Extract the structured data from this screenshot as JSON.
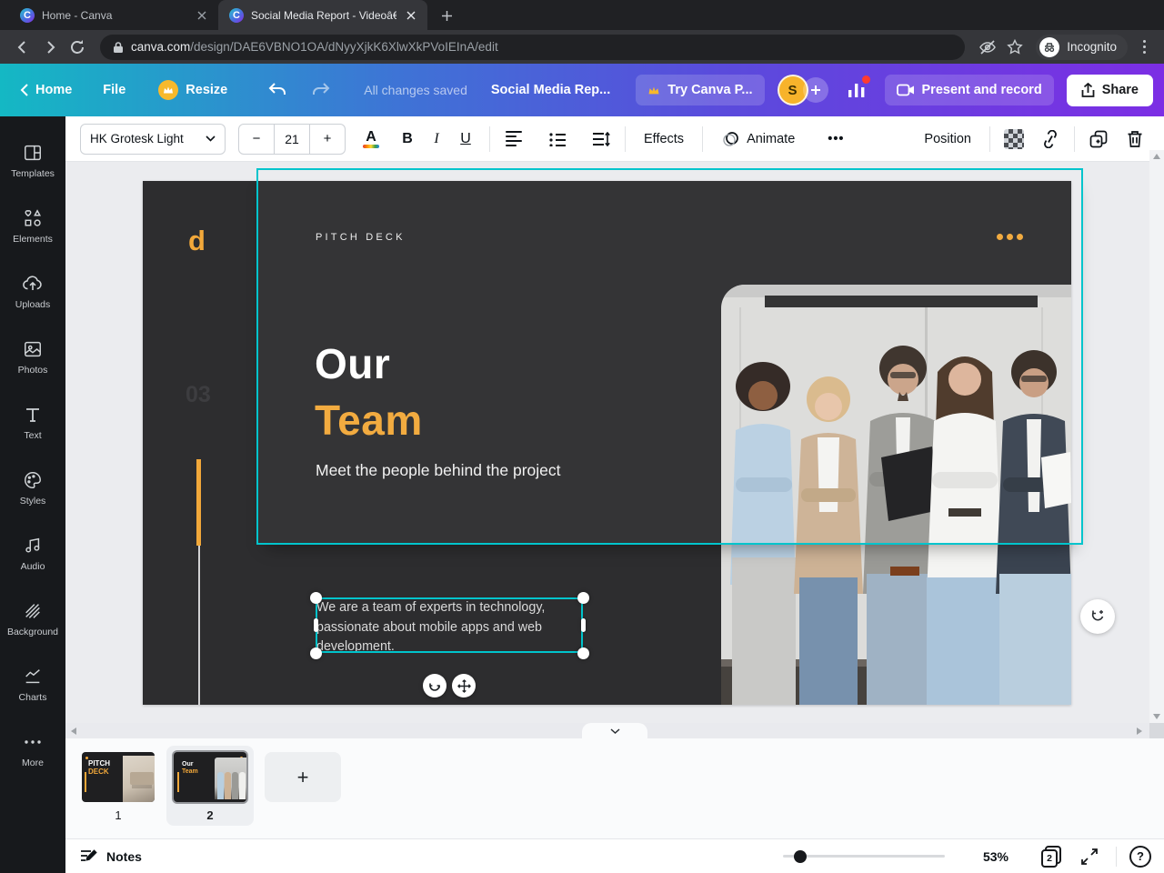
{
  "browser": {
    "tabs": [
      {
        "title": "Home - Canva"
      },
      {
        "title": "Social Media Report - Videoâ€¦"
      }
    ],
    "url_domain": "canva.com",
    "url_path": "/design/DAE6VBNO1OA/dNyyXjkK6XlwXkPVoIEInA/edit",
    "incognito_label": "Incognito"
  },
  "header": {
    "home_label": "Home",
    "file_label": "File",
    "resize_label": "Resize",
    "saved_status": "All changes saved",
    "doc_title": "Social Media Rep...",
    "try_pro_label": "Try Canva P...",
    "avatar_initial": "S",
    "present_label": "Present and record",
    "share_label": "Share"
  },
  "toolbar": {
    "font_name": "HK Grotesk Light",
    "font_size": "21",
    "minus": "−",
    "plus": "+",
    "color_label": "A",
    "bold": "B",
    "italic": "I",
    "underline": "U",
    "effects_label": "Effects",
    "animate_label": "Animate",
    "more": "•••",
    "position_label": "Position"
  },
  "sidebar": {
    "items": [
      {
        "label": "Templates"
      },
      {
        "label": "Elements"
      },
      {
        "label": "Uploads"
      },
      {
        "label": "Photos"
      },
      {
        "label": "Text"
      },
      {
        "label": "Styles"
      },
      {
        "label": "Audio"
      },
      {
        "label": "Background"
      },
      {
        "label": "Charts"
      },
      {
        "label": "More"
      }
    ]
  },
  "slide": {
    "logo_letter": "d",
    "kicker": "PITCH DECK",
    "page_number": "03",
    "title_line1": "Our",
    "title_line2": "Team",
    "subtitle": "Meet the people behind the project",
    "body_text": "We are a team of experts in technology, passionate about mobile apps and web development."
  },
  "pages": {
    "thumb1_line1": "PITCH",
    "thumb1_line2": "DECK",
    "thumb2_line1": "Our",
    "thumb2_line2": "Team",
    "page1_label": "1",
    "page2_label": "2",
    "add_label": "+"
  },
  "statusbar": {
    "notes_label": "Notes",
    "zoom_level": "53%",
    "page_count": "2",
    "help_label": "?"
  },
  "colors": {
    "accent_yellow": "#f2a83a",
    "selection_cyan": "#00c4cc",
    "header_gradient_start": "#14b8c4",
    "header_gradient_end": "#7c2ee4",
    "slide_background": "#2d2d2f"
  }
}
